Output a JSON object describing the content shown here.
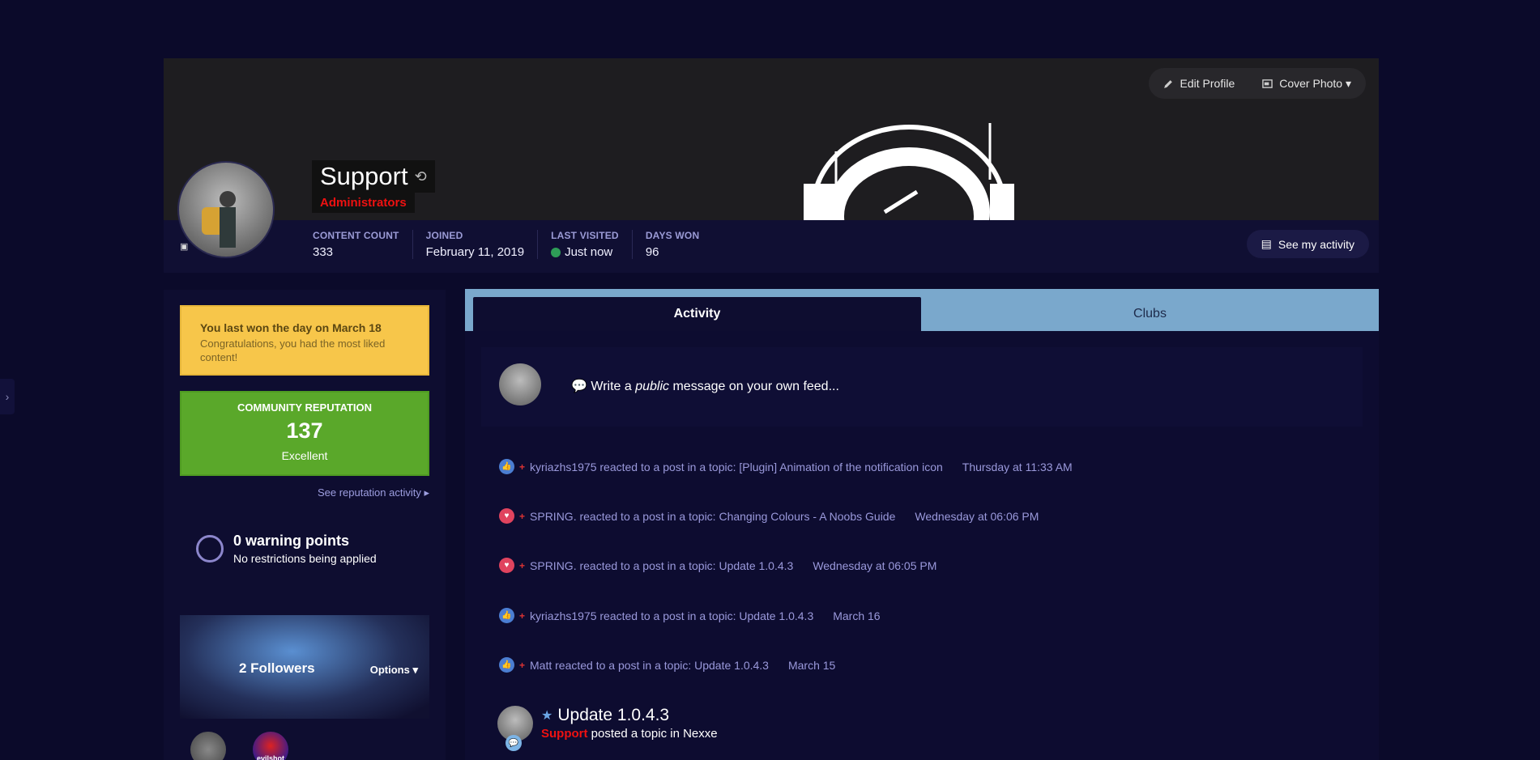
{
  "cover": {
    "edit_profile": "Edit Profile",
    "cover_photo": "Cover Photo ▾"
  },
  "profile": {
    "name": "Support",
    "group": "Administrators",
    "stats": [
      {
        "label": "CONTENT COUNT",
        "value": "333"
      },
      {
        "label": "JOINED",
        "value": "February 11, 2019"
      },
      {
        "label": "LAST VISITED",
        "value": "Just now"
      },
      {
        "label": "DAYS WON",
        "value": "96"
      }
    ],
    "see_activity": "See my activity"
  },
  "sidebar": {
    "trophy_title": "You last won the day on March 18",
    "trophy_text": "Congratulations, you had the most liked content!",
    "rep_label": "COMMUNITY REPUTATION",
    "rep_value": "137",
    "rep_level": "Excellent",
    "rep_link": "See reputation activity ▸",
    "warn_title": "0 warning points",
    "warn_text": "No restrictions being applied",
    "followers_count": "2 Followers",
    "followers_options": "Options ▾",
    "follower2_name": "evilshot"
  },
  "tabs": [
    "Activity",
    "Clubs"
  ],
  "composer": {
    "prefix": "Write a ",
    "emphasis": "public",
    "suffix": " message on your own feed..."
  },
  "activity": [
    {
      "icon": "like",
      "text": "kyriazhs1975 reacted to a post in a topic: [Plugin] Animation of the notification icon",
      "date": "Thursday at 11:33 AM"
    },
    {
      "icon": "love",
      "text": "SPRING. reacted to a post in a topic: Changing Colours - A Noobs Guide",
      "date": "Wednesday at 06:06 PM"
    },
    {
      "icon": "love",
      "text": "SPRING. reacted to a post in a topic: Update 1.0.4.3",
      "date": "Wednesday at 06:05 PM"
    },
    {
      "icon": "like",
      "text": "kyriazhs1975 reacted to a post in a topic: Update 1.0.4.3",
      "date": "March 16"
    },
    {
      "icon": "like",
      "text": "Matt reacted to a post in a topic: Update 1.0.4.3",
      "date": "March 15"
    }
  ],
  "post": {
    "title": "Update 1.0.4.3",
    "author": "Support",
    "action": " posted a topic in Nexxe"
  },
  "colors": {
    "background": "#0b0a2a",
    "accent": "#7aa8cc",
    "group": "#e11111",
    "reputation": "#5aa82a",
    "trophy": "#f7c64a"
  }
}
